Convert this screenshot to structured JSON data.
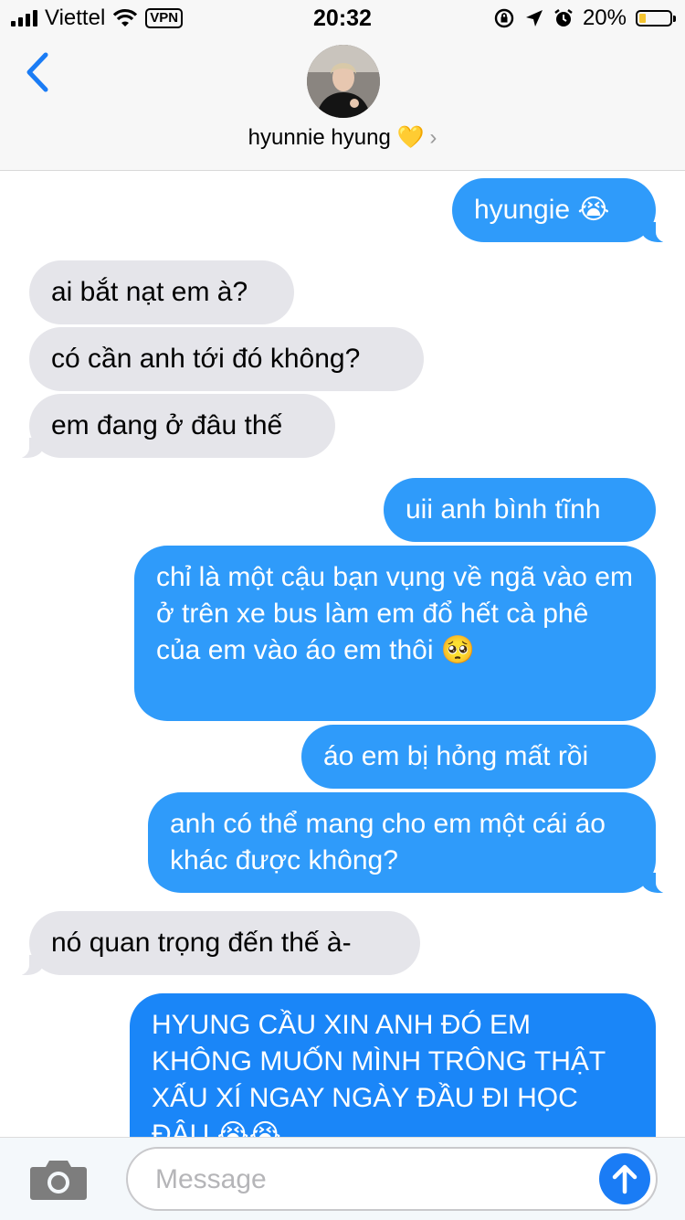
{
  "status_bar": {
    "carrier": "Viettel",
    "vpn": "VPN",
    "time": "20:32",
    "battery": "20%",
    "battery_level": 0.2,
    "icons": [
      "signal-icon",
      "wifi-icon",
      "vpn-badge",
      "rotation-lock-icon",
      "location-icon",
      "alarm-icon",
      "battery-icon"
    ]
  },
  "header": {
    "contact_name": "hyunnie hyung 💛",
    "chevron": "›"
  },
  "messages": [
    {
      "from": "me",
      "text": "hyungie 😭"
    },
    {
      "from": "them",
      "text": "ai bắt nạt em à?"
    },
    {
      "from": "them",
      "text": "có cần anh tới đó không?"
    },
    {
      "from": "them",
      "text": "em đang ở đâu thế"
    },
    {
      "from": "me",
      "text": "uii anh bình tĩnh"
    },
    {
      "from": "me",
      "text": "chỉ là một cậu bạn vụng về ngã vào em ở trên xe bus làm em đổ hết cà phê của em vào áo em thôi 🥺"
    },
    {
      "from": "me",
      "text": "áo em bị hỏng mất rồi"
    },
    {
      "from": "me",
      "text": "anh có thể mang cho em một cái áo khác được không?"
    },
    {
      "from": "them",
      "text": "nó quan trọng đến thế à-"
    },
    {
      "from": "me",
      "text": "HYUNG CẦU XIN ANH ĐÓ EM KHÔNG MUỐN MÌNH TRÔNG THẬT XẤU XÍ NGAY NGÀY ĐẦU ĐI HỌC ĐÂU 😭😭"
    }
  ],
  "input": {
    "placeholder": "Message"
  },
  "colors": {
    "sent_bubble": "#2f9bfa",
    "received_bubble": "#e5e5ea",
    "accent": "#1a7cf5"
  }
}
